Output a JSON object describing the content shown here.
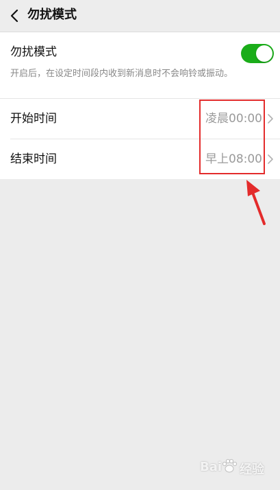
{
  "header": {
    "title": "勿扰模式",
    "back_icon": "back-chevron-icon"
  },
  "dnd": {
    "label": "勿扰模式",
    "description": "开启后，在设定时间段内收到新消息时不会响铃或振动。",
    "enabled": true,
    "switch_color": "#1aad19"
  },
  "schedule": {
    "start": {
      "label": "开始时间",
      "value": "凌晨00:00"
    },
    "end": {
      "label": "结束时间",
      "value": "早上08:00"
    }
  },
  "annotation": {
    "box_color": "#e32b2b",
    "arrow_color": "#e32b2b"
  },
  "watermark": {
    "text_left": "Bai",
    "text_right": "经验"
  }
}
